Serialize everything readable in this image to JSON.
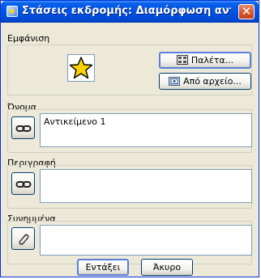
{
  "window": {
    "title": "Στάσεις εκδρομής: Διαμόρφωση αντικει...",
    "close_glyph": "✕"
  },
  "appearance": {
    "label": "Εμφάνιση",
    "icon": "star-icon",
    "palette_button": "Παλέτα...",
    "from_file_button": "Από αρχείο..."
  },
  "name": {
    "label": "Όνομα",
    "value": "Αντικείμενο 1",
    "link_icon": "chain-link-icon"
  },
  "description": {
    "label": "Περιγραφή",
    "value": "",
    "link_icon": "chain-link-icon"
  },
  "attachments": {
    "label": "Συνημμένα",
    "value": "",
    "icon": "paperclip-icon"
  },
  "footer": {
    "ok_button": "Εντάξει",
    "cancel_button": "Άκυρο"
  },
  "colors": {
    "titlebar": "#0054e3",
    "window_bg": "#ece9d8",
    "star_fill": "#ffd200",
    "close_button": "#d6512b"
  }
}
